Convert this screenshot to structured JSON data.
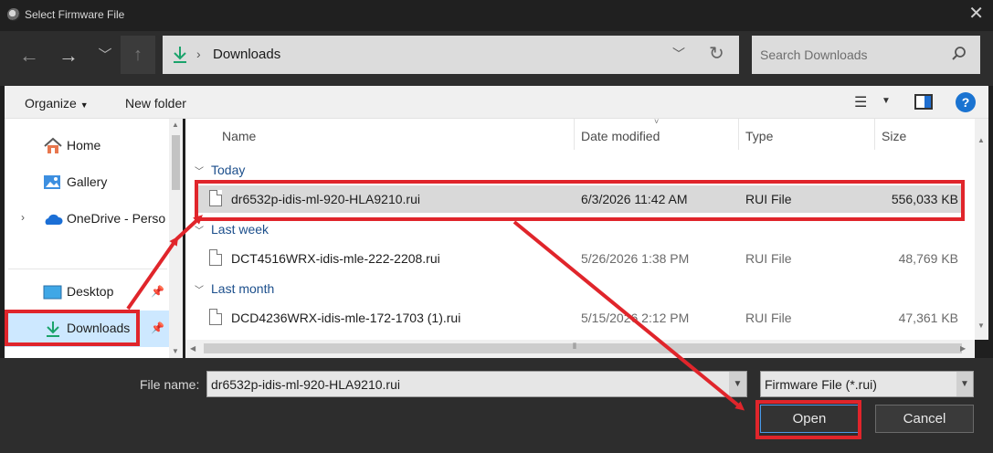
{
  "window": {
    "title": "Select Firmware File"
  },
  "navbar": {
    "breadcrumb": "Downloads",
    "search_placeholder": "Search Downloads"
  },
  "commandbar": {
    "organize": "Organize",
    "new_folder": "New folder"
  },
  "navpane": {
    "items": [
      {
        "label": "Home",
        "icon": "home-icon"
      },
      {
        "label": "Gallery",
        "icon": "gallery-icon"
      },
      {
        "label": "OneDrive - Perso",
        "icon": "onedrive-icon"
      },
      {
        "label": "Desktop",
        "icon": "desktop-icon",
        "pinned": true
      },
      {
        "label": "Downloads",
        "icon": "downloads-icon",
        "pinned": true,
        "selected": true
      }
    ]
  },
  "filelist": {
    "columns": [
      "Name",
      "Date modified",
      "Type",
      "Size"
    ],
    "groups": [
      {
        "label": "Today",
        "files": [
          {
            "name": "dr6532p-idis-ml-920-HLA9210.rui",
            "date": "6/3/2026 11:42 AM",
            "type": "RUI File",
            "size": "556,033 KB",
            "selected": true
          }
        ]
      },
      {
        "label": "Last week",
        "files": [
          {
            "name": "DCT4516WRX-idis-mle-222-2208.rui",
            "date": "5/26/2026 1:38 PM",
            "type": "RUI File",
            "size": "48,769 KB"
          }
        ]
      },
      {
        "label": "Last month",
        "files": [
          {
            "name": "DCD4236WRX-idis-mle-172-1703 (1).rui",
            "date": "5/15/2026 2:12 PM",
            "type": "RUI File",
            "size": "47,361 KB"
          }
        ]
      }
    ]
  },
  "bottom": {
    "file_name_label": "File name:",
    "file_name_value": "dr6532p-idis-ml-920-HLA9210.rui",
    "filter": "Firmware File (*.rui)",
    "open": "Open",
    "cancel": "Cancel"
  },
  "colors": {
    "annotation": "#e0252b",
    "selection": "#cde8ff",
    "accent": "#1a73d1"
  }
}
